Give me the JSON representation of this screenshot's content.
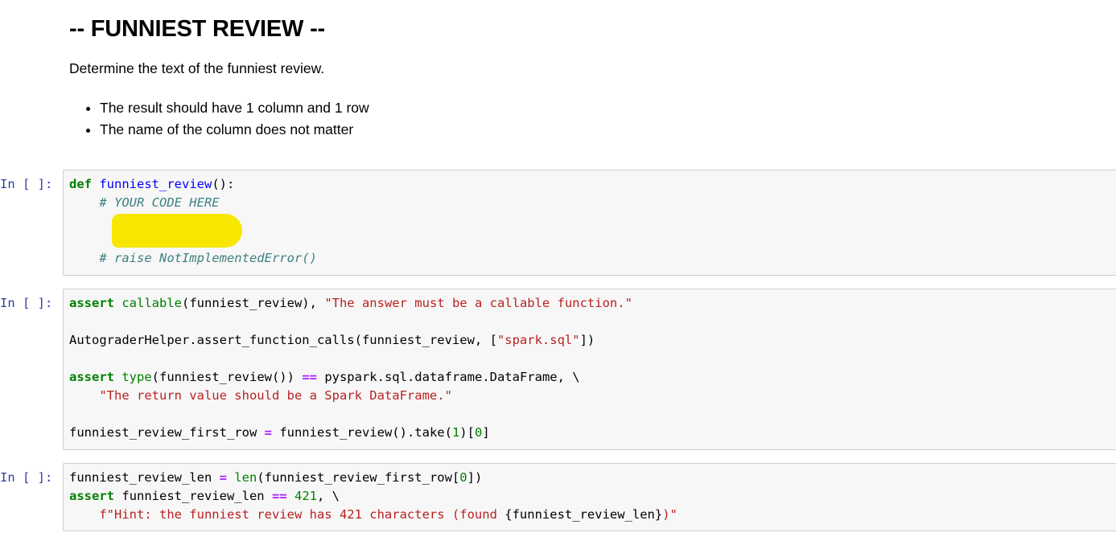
{
  "markdown": {
    "heading": "-- FUNNIEST REVIEW --",
    "description": "Determine the text of the funniest review.",
    "bullets": [
      "The result should have 1 column and 1 row",
      "The name of the column does not matter"
    ]
  },
  "prompt_label": "In [ ]:",
  "cells": [
    {
      "lines": [
        [
          {
            "t": "def",
            "c": "kw"
          },
          {
            "t": " ",
            "c": ""
          },
          {
            "t": "funniest_review",
            "c": "fn"
          },
          {
            "t": "():",
            "c": ""
          }
        ],
        [
          {
            "t": "    ",
            "c": ""
          },
          {
            "t": "# YOUR CODE HERE",
            "c": "cm"
          }
        ],
        [],
        [],
        [
          {
            "t": "    ",
            "c": ""
          },
          {
            "t": "# raise NotImplementedError()",
            "c": "cm"
          }
        ]
      ]
    },
    {
      "lines": [
        [
          {
            "t": "assert",
            "c": "kw"
          },
          {
            "t": " ",
            "c": ""
          },
          {
            "t": "callable",
            "c": "bi"
          },
          {
            "t": "(funniest_review), ",
            "c": ""
          },
          {
            "t": "\"The answer must be a callable function.\"",
            "c": "st"
          }
        ],
        [],
        [
          {
            "t": "AutograderHelper.assert_function_calls(funniest_review, [",
            "c": ""
          },
          {
            "t": "\"spark.sql\"",
            "c": "st"
          },
          {
            "t": "])",
            "c": ""
          }
        ],
        [],
        [
          {
            "t": "assert",
            "c": "kw"
          },
          {
            "t": " ",
            "c": ""
          },
          {
            "t": "type",
            "c": "bi"
          },
          {
            "t": "(funniest_review()) ",
            "c": ""
          },
          {
            "t": "==",
            "c": "op"
          },
          {
            "t": " pyspark.sql.dataframe.DataFrame, \\",
            "c": ""
          }
        ],
        [
          {
            "t": "    ",
            "c": ""
          },
          {
            "t": "\"The return value should be a Spark DataFrame.\"",
            "c": "st"
          }
        ],
        [],
        [
          {
            "t": "funniest_review_first_row ",
            "c": ""
          },
          {
            "t": "=",
            "c": "op"
          },
          {
            "t": " funniest_review().take(",
            "c": ""
          },
          {
            "t": "1",
            "c": "nm"
          },
          {
            "t": ")[",
            "c": ""
          },
          {
            "t": "0",
            "c": "nm"
          },
          {
            "t": "]",
            "c": ""
          }
        ]
      ]
    },
    {
      "lines": [
        [
          {
            "t": "funniest_review_len ",
            "c": ""
          },
          {
            "t": "=",
            "c": "op"
          },
          {
            "t": " ",
            "c": ""
          },
          {
            "t": "len",
            "c": "bi"
          },
          {
            "t": "(funniest_review_first_row[",
            "c": ""
          },
          {
            "t": "0",
            "c": "nm"
          },
          {
            "t": "])",
            "c": ""
          }
        ],
        [
          {
            "t": "assert",
            "c": "kw"
          },
          {
            "t": " funniest_review_len ",
            "c": ""
          },
          {
            "t": "==",
            "c": "op"
          },
          {
            "t": " ",
            "c": ""
          },
          {
            "t": "421",
            "c": "nm"
          },
          {
            "t": ", \\",
            "c": ""
          }
        ],
        [
          {
            "t": "    ",
            "c": ""
          },
          {
            "t": "f\"Hint: the funniest review has 421 characters (found ",
            "c": "st"
          },
          {
            "t": "{funniest_review_len}",
            "c": ""
          },
          {
            "t": ")\"",
            "c": "st"
          }
        ]
      ]
    }
  ],
  "highlight_color": "#f7e600"
}
